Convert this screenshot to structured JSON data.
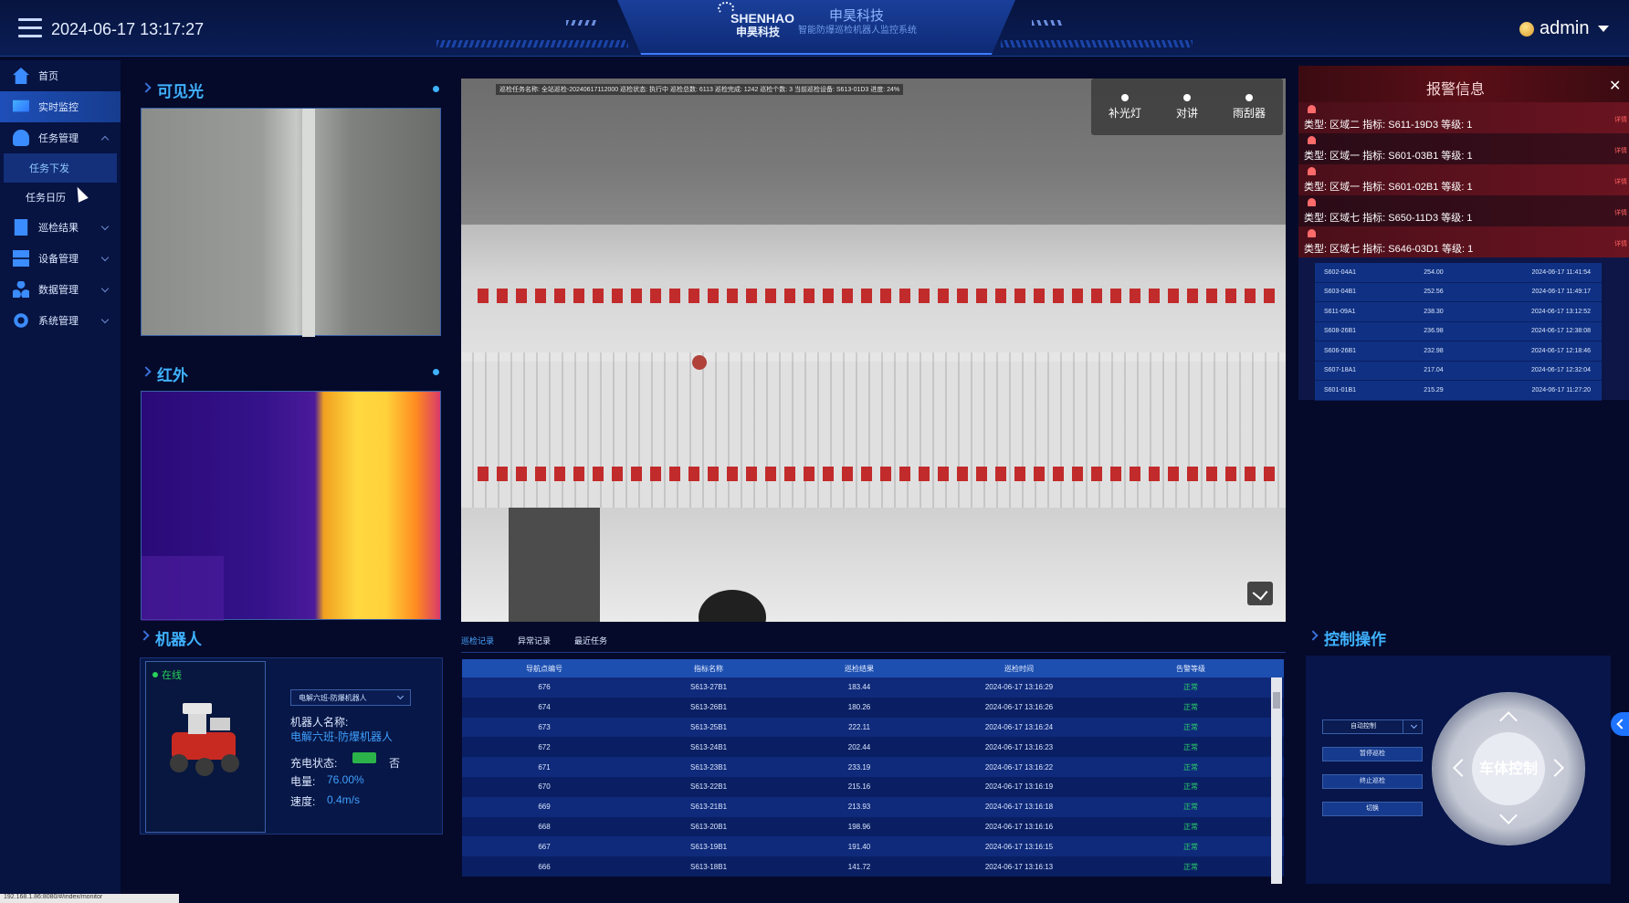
{
  "header": {
    "datetime": "2024-06-17 13:17:27",
    "logo_en": "SHENHAO",
    "logo_cn": "申昊科技",
    "brand_cn": "申昊科技",
    "brand_sub": "智能防爆巡检机器人监控系统",
    "user": "admin"
  },
  "sidebar": {
    "items": [
      {
        "label": "首页",
        "icon": "home-icon"
      },
      {
        "label": "实时监控",
        "icon": "monitor-icon"
      },
      {
        "label": "任务管理",
        "icon": "task-icon"
      },
      {
        "label": "任务下发",
        "icon": ""
      },
      {
        "label": "任务日历",
        "icon": ""
      },
      {
        "label": "巡检结果",
        "icon": "result-icon"
      },
      {
        "label": "设备管理",
        "icon": "device-icon"
      },
      {
        "label": "数据管理",
        "icon": "data-icon"
      },
      {
        "label": "系统管理",
        "icon": "settings-icon"
      }
    ]
  },
  "panels": {
    "visible": "可见光",
    "infrared": "红外",
    "robot": "机器人",
    "control": "控制操作"
  },
  "robot": {
    "status": "在线",
    "select": "电解六班-防爆机器人",
    "name_label": "机器人名称:",
    "name_value": "电解六班-防爆机器人",
    "charge_label": "充电状态:",
    "charge_value": "否",
    "battery_label": "电量:",
    "battery_value": "76.00%",
    "speed_label": "速度:",
    "speed_value": "0.4m/s"
  },
  "video": {
    "osd": "巡检任务名称: 全站巡检-20240617112000 巡检状态: 执行中 巡检总数: 6113 巡检完成: 1242 巡检个数: 3 当前巡检设备: S613-01D3 进度: 24%",
    "tools": [
      "补光灯",
      "对讲",
      "雨刮器"
    ]
  },
  "tabs": [
    "巡检记录",
    "异常记录",
    "最近任务"
  ],
  "table": {
    "headers": [
      "导航点编号",
      "指标名称",
      "巡检结果",
      "巡检时间",
      "告警等级"
    ],
    "rows": [
      [
        "676",
        "S613-27B1",
        "183.44",
        "2024-06-17 13:16:29",
        "正常"
      ],
      [
        "674",
        "S613-26B1",
        "180.26",
        "2024-06-17 13:16:26",
        "正常"
      ],
      [
        "673",
        "S613-25B1",
        "222.11",
        "2024-06-17 13:16:24",
        "正常"
      ],
      [
        "672",
        "S613-24B1",
        "202.44",
        "2024-06-17 13:16:23",
        "正常"
      ],
      [
        "671",
        "S613-23B1",
        "233.19",
        "2024-06-17 13:16:22",
        "正常"
      ],
      [
        "670",
        "S613-22B1",
        "215.16",
        "2024-06-17 13:16:19",
        "正常"
      ],
      [
        "669",
        "S613-21B1",
        "213.93",
        "2024-06-17 13:16:18",
        "正常"
      ],
      [
        "668",
        "S613-20B1",
        "198.96",
        "2024-06-17 13:16:16",
        "正常"
      ],
      [
        "667",
        "S613-19B1",
        "191.40",
        "2024-06-17 13:16:15",
        "正常"
      ],
      [
        "666",
        "S613-18B1",
        "141.72",
        "2024-06-17 13:16:13",
        "正常"
      ]
    ]
  },
  "alarm": {
    "title": "报警信息",
    "items": [
      {
        "text": "类型: 区域二   指标: S611-19D3   等级: 1",
        "tag": "详情"
      },
      {
        "text": "类型: 区域一   指标: S601-03B1   等级: 1",
        "tag": "详情"
      },
      {
        "text": "类型: 区域一   指标: S601-02B1   等级: 1",
        "tag": "详情"
      },
      {
        "text": "类型: 区域七   指标: S650-11D3   等级: 1",
        "tag": "详情"
      },
      {
        "text": "类型: 区域七   指标: S646-03D1   等级: 1",
        "tag": "详情"
      }
    ],
    "list": [
      [
        "S602-04A1",
        "254.00",
        "2024-06-17 11:41:54"
      ],
      [
        "S603-04B1",
        "252.56",
        "2024-06-17 11:49:17"
      ],
      [
        "S611-09A1",
        "238.30",
        "2024-06-17 13:12:52"
      ],
      [
        "S608-26B1",
        "236.98",
        "2024-06-17 12:38:08"
      ],
      [
        "S606-26B1",
        "232.98",
        "2024-06-17 12:18:46"
      ],
      [
        "S607-18A1",
        "217.04",
        "2024-06-17 12:32:04"
      ],
      [
        "S601-01B1",
        "215.29",
        "2024-06-17 11:27:20"
      ]
    ]
  },
  "control": {
    "mode": "自动控制",
    "buttons": [
      "暂停巡检",
      "终止巡检",
      "切换"
    ],
    "joystick": "车体控制"
  },
  "statusbar": "192.168.1.86:8080/#/index/monitor"
}
